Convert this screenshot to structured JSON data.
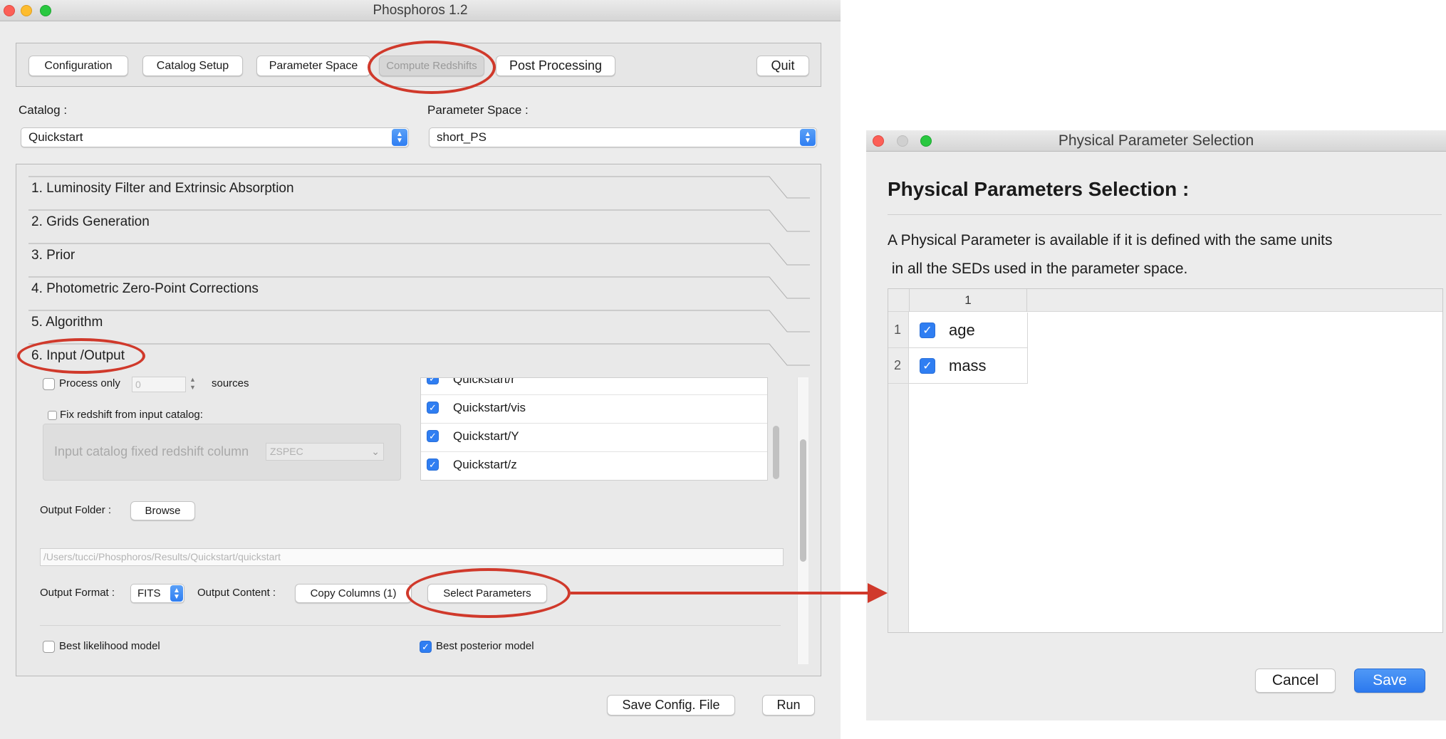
{
  "main_window": {
    "title": "Phosphoros 1.2",
    "tabs": [
      "Configuration",
      "Catalog Setup",
      "Parameter Space",
      "Compute Redshifts",
      "Post Processing"
    ],
    "quit_label": "Quit",
    "catalog_label": "Catalog :",
    "catalog_value": "Quickstart",
    "param_space_label": "Parameter Space :",
    "param_space_value": "short_PS",
    "sections": [
      "1. Luminosity Filter and Extrinsic Absorption",
      "2. Grids Generation",
      "3. Prior",
      "4. Photometric Zero-Point Corrections",
      "5. Algorithm",
      "6. Input /Output"
    ],
    "io": {
      "process_only_label": "Process only",
      "process_only_value": "0",
      "sources_label": "sources",
      "fix_redshift_label": "Fix redshift from input catalog:",
      "fixed_column_label": "Input catalog fixed redshift column",
      "fixed_column_value": "ZSPEC",
      "filters": [
        "Quickstart/r",
        "Quickstart/vis",
        "Quickstart/Y",
        "Quickstart/z"
      ],
      "output_folder_label": "Output Folder :",
      "browse_label": "Browse",
      "output_path": "/Users/tucci/Phosphoros/Results/Quickstart/quickstart",
      "output_format_label": "Output Format :",
      "output_format_value": "FITS",
      "output_content_label": "Output Content :",
      "copy_columns_label": "Copy Columns (1)",
      "select_parameters_label": "Select Parameters",
      "best_likelihood_label": "Best likelihood model",
      "best_posterior_label": "Best posterior model"
    },
    "save_config_label": "Save Config. File",
    "run_label": "Run"
  },
  "dialog": {
    "title": "Physical Parameter Selection",
    "heading": "Physical Parameters Selection :",
    "description_line1": "A Physical Parameter is available if it is defined with the same units",
    "description_line2": " in all the SEDs used in the parameter space.",
    "table_header": "1",
    "rows": [
      {
        "index": "1",
        "name": "age",
        "checked": true
      },
      {
        "index": "2",
        "name": "mass",
        "checked": true
      }
    ],
    "cancel_label": "Cancel",
    "save_label": "Save"
  },
  "colors": {
    "accent": "#2f7ef2",
    "annotation": "#d0392b",
    "window_bg": "#ececec"
  }
}
